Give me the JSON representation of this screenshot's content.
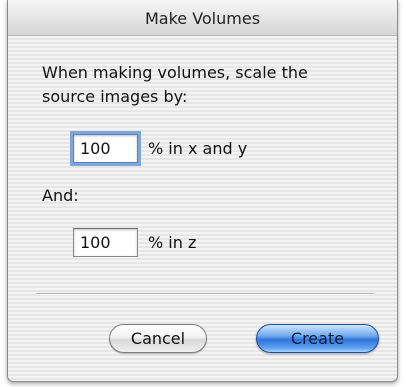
{
  "dialog": {
    "title": "Make Volumes",
    "prompt_line1": "When making volumes, scale the",
    "prompt_line2": "source images by:",
    "xy_value": "100",
    "xy_unit_label": "% in x and y",
    "and_label": "And:",
    "z_value": "100",
    "z_unit_label": "% in z",
    "cancel_label": "Cancel",
    "create_label": "Create"
  }
}
